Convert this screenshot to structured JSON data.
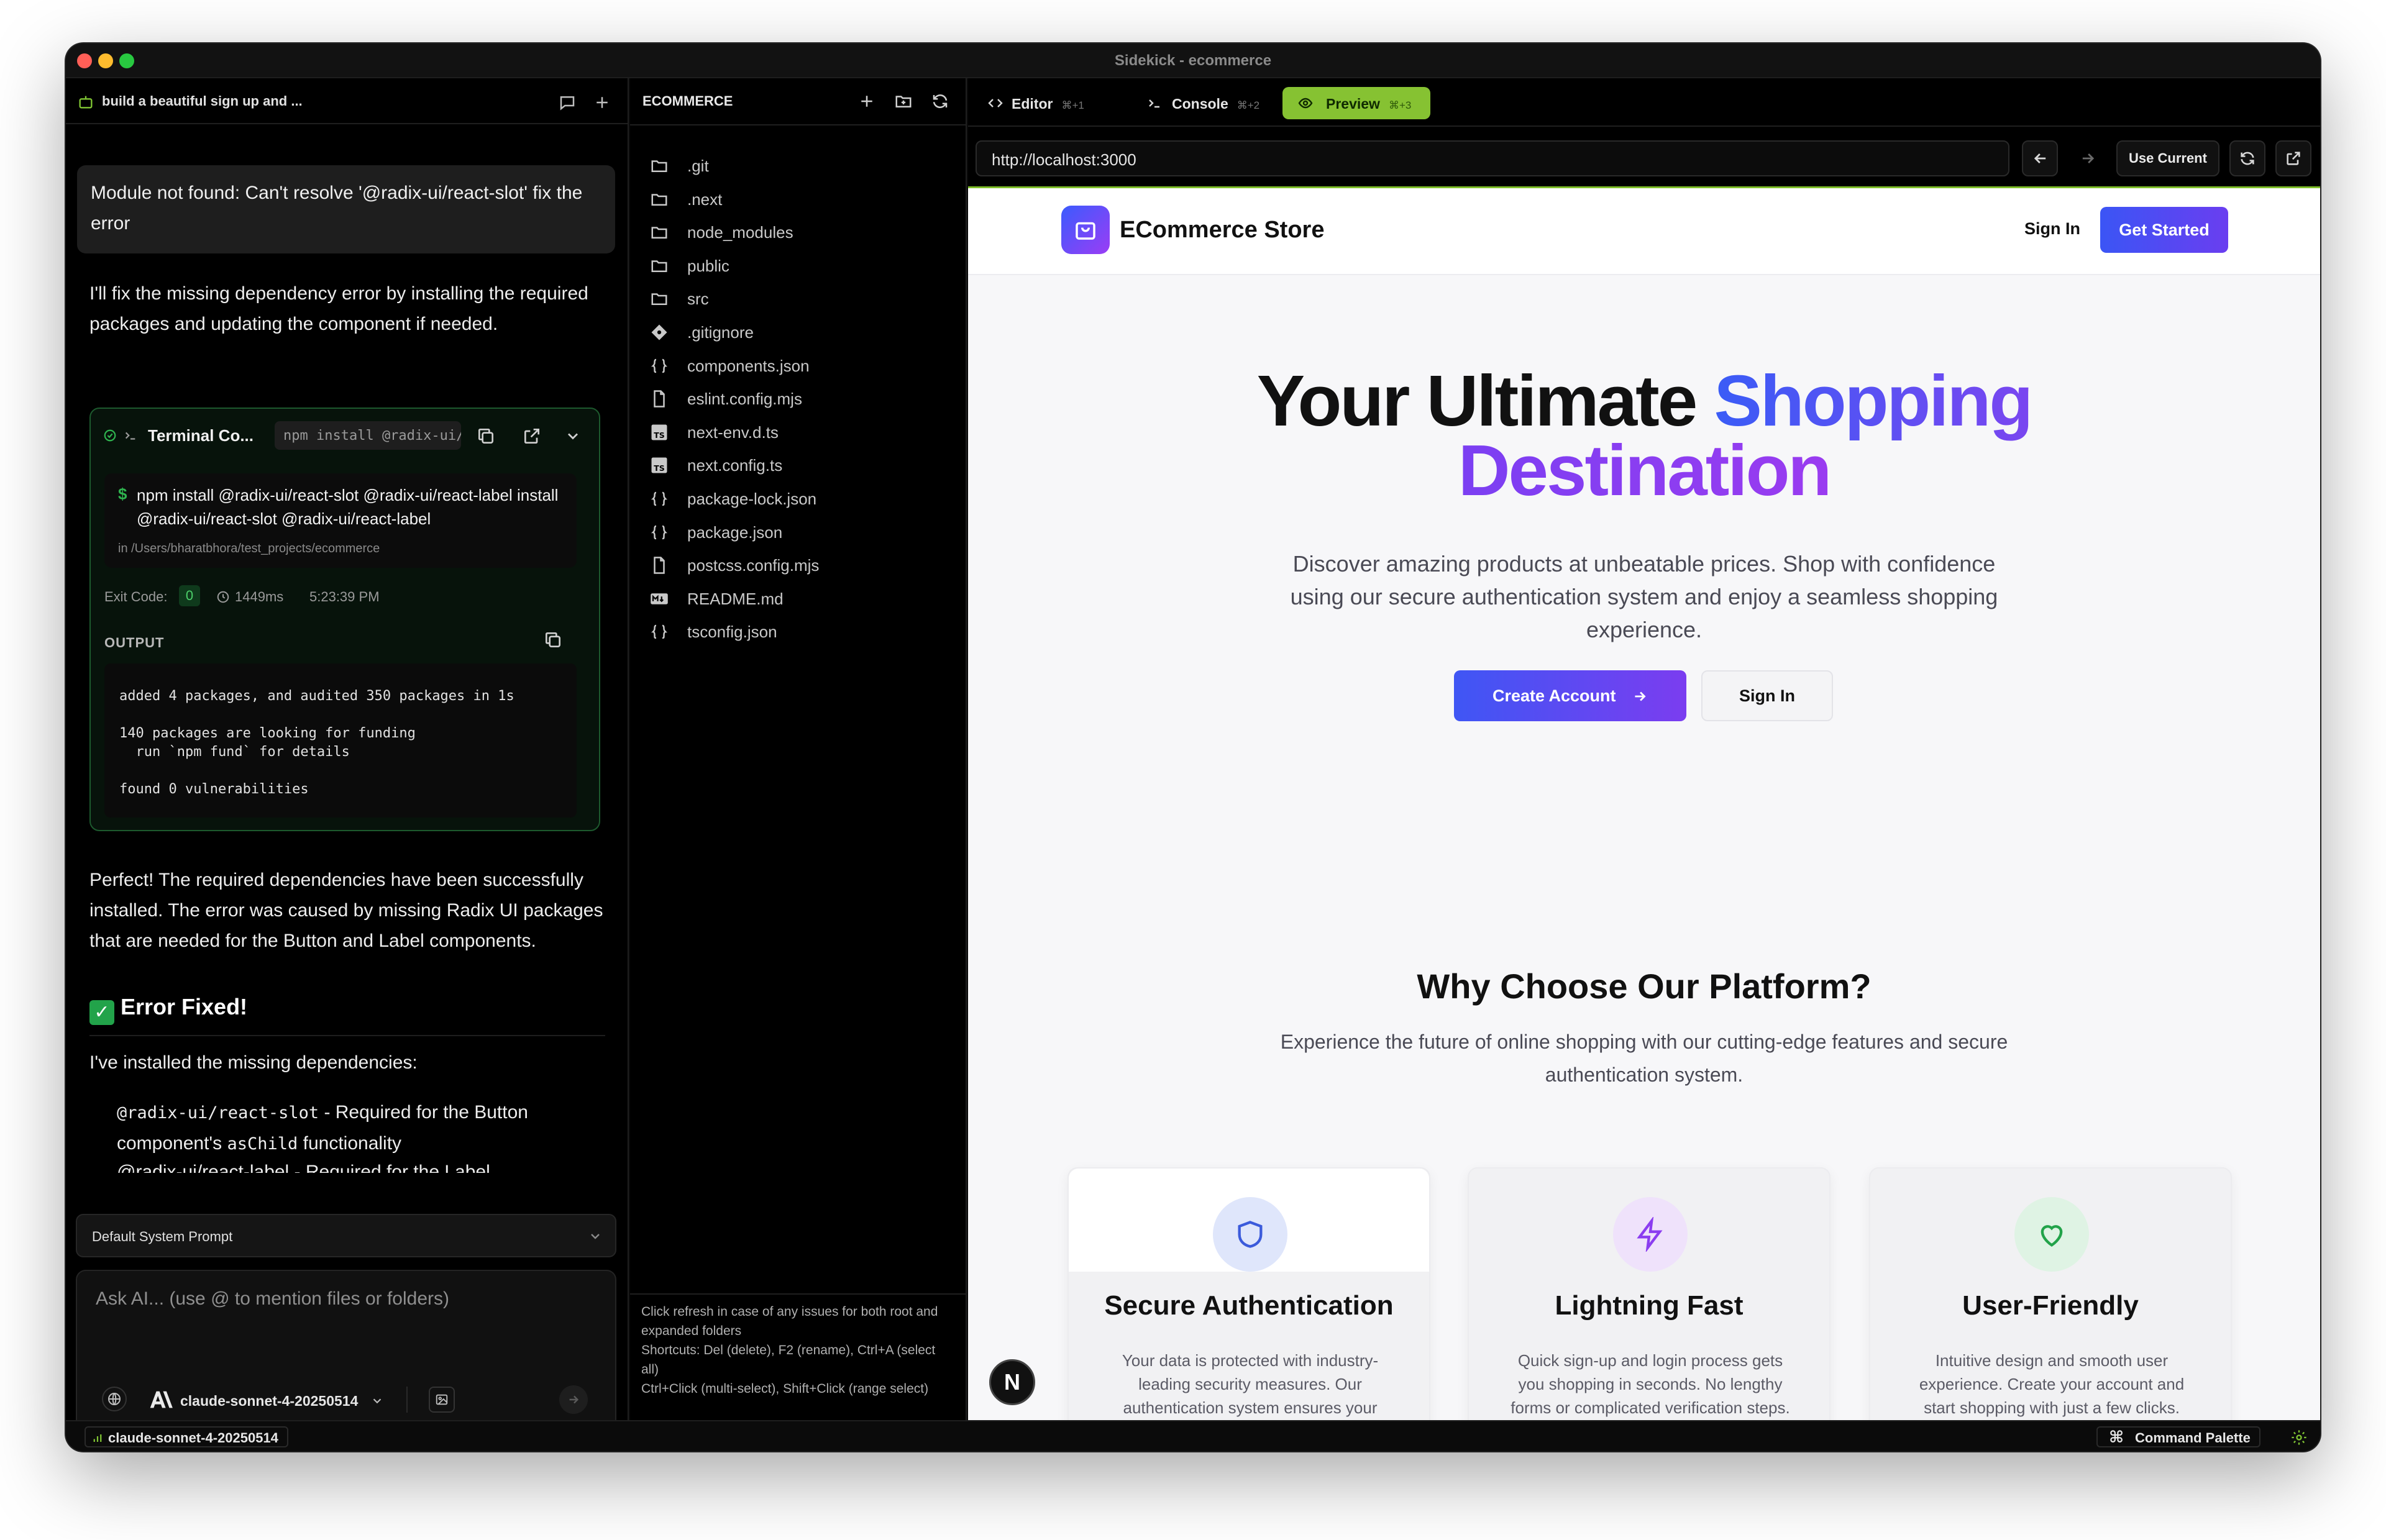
{
  "window": {
    "title": "Sidekick - ecommerce",
    "lights": [
      "#ff5f57",
      "#febc2e",
      "#28c840"
    ]
  },
  "chat": {
    "thread_title": "build a beautiful sign up and ...",
    "user_message": "Module not found: Can't resolve '@radix-ui/react-slot' fix the error",
    "assistant_intro": "I'll fix the missing dependency error by installing the required packages and updating the component if needed.",
    "terminal": {
      "title": "Terminal Co...",
      "command_pill": "npm install @radix-ui/re...",
      "prompt_symbol": "$",
      "command": "npm install @radix-ui/react-slot @radix-ui/react-label install @radix-ui/react-slot @radix-ui/react-label",
      "cwd": "in /Users/bharatbhora/test_projects/ecommerce",
      "exit_label": "Exit Code:",
      "exit_code": "0",
      "duration": "1449ms",
      "time": "5:23:39 PM",
      "output_label": "OUTPUT",
      "output": "added 4 packages, and audited 350 packages in 1s\n\n140 packages are looking for funding\n  run `npm fund` for details\n\nfound 0 vulnerabilities"
    },
    "assistant_summary": "Perfect! The required dependencies have been successfully installed. The error was caused by missing Radix UI packages that are needed for the Button and Label components.",
    "fixed_heading": "Error Fixed!",
    "installed_intro": "I've installed the missing dependencies:",
    "dep1_code": "@radix-ui/react-slot",
    "dep1_text": " - Required for the Button",
    "dep1_line2_a": "component's ",
    "dep1_line2_code": "asChild",
    "dep1_line2_b": " functionality",
    "dep2_partial": "@radix-ui/react-label - Required for the Label",
    "system_prompt": "Default System Prompt",
    "input_placeholder": "Ask AI... (use @ to mention files or folders)",
    "model": "claude-sonnet-4-20250514"
  },
  "explorer": {
    "header": "ECOMMERCE",
    "items": [
      {
        "name": ".git",
        "icon": "folder-icon"
      },
      {
        "name": ".next",
        "icon": "folder-icon"
      },
      {
        "name": "node_modules",
        "icon": "folder-icon"
      },
      {
        "name": "public",
        "icon": "folder-icon"
      },
      {
        "name": "src",
        "icon": "folder-icon"
      },
      {
        "name": ".gitignore",
        "icon": "git-icon"
      },
      {
        "name": "components.json",
        "icon": "json-icon"
      },
      {
        "name": "eslint.config.mjs",
        "icon": "file-icon"
      },
      {
        "name": "next-env.d.ts",
        "icon": "ts-icon"
      },
      {
        "name": "next.config.ts",
        "icon": "ts-icon"
      },
      {
        "name": "package-lock.json",
        "icon": "json-icon"
      },
      {
        "name": "package.json",
        "icon": "json-icon"
      },
      {
        "name": "postcss.config.mjs",
        "icon": "file-icon"
      },
      {
        "name": "README.md",
        "icon": "markdown-icon"
      },
      {
        "name": "tsconfig.json",
        "icon": "json-icon"
      }
    ],
    "help_lines": [
      "Click refresh in case of any issues for both root and expanded folders",
      "Shortcuts: Del (delete), F2 (rename), Ctrl+A (select all)",
      "Ctrl+Click (multi-select), Shift+Click (range select)"
    ]
  },
  "tabs": {
    "editor": "Editor",
    "editor_kb": "⌘+1",
    "console": "Console",
    "console_kb": "⌘+2",
    "preview": "Preview",
    "preview_kb": "⌘+3"
  },
  "browser": {
    "url": "http://localhost:3000",
    "use_current": "Use Current"
  },
  "site": {
    "brand": "ECommerce Store",
    "nav_signin": "Sign In",
    "nav_get_started": "Get Started",
    "hero_title_a": "Your Ultimate ",
    "hero_title_b": "Shopping",
    "hero_title_c": "Destination",
    "hero_sub": "Discover amazing products at unbeatable prices. Shop with confidence using our secure authentication system and enjoy a seamless shopping experience.",
    "cta_create": "Create Account",
    "cta_signin": "Sign In",
    "why_title": "Why Choose Our Platform?",
    "why_sub": "Experience the future of online shopping with our cutting-edge features and secure authentication system.",
    "features": [
      {
        "title": "Secure Authentication",
        "desc": "Your data is protected with industry-leading security measures. Our authentication system ensures your account stays safe.",
        "icon": "shield-icon",
        "color": "#3b5bdb"
      },
      {
        "title": "Lightning Fast",
        "desc": "Quick sign-up and login process gets you shopping in seconds. No lengthy forms or complicated verification steps.",
        "icon": "lightning-icon",
        "color": "#8b3df0"
      },
      {
        "title": "User-Friendly",
        "desc": "Intuitive design and smooth user experience. Create your account and start shopping with just a few clicks.",
        "icon": "heart-icon",
        "color": "#22a34a"
      }
    ],
    "next_badge": "N"
  },
  "statusbar": {
    "model": "claude-sonnet-4-20250514",
    "palette": "Command Palette"
  }
}
